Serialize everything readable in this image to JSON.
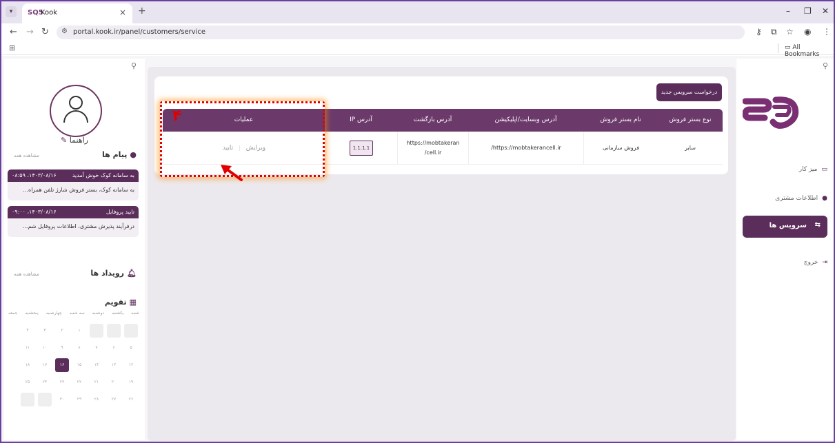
{
  "browser": {
    "tab_title": "Kook",
    "tab_favicon": "SQ5",
    "url": "portal.kook.ir/panel/customers/service",
    "all_bookmarks": "All Bookmarks"
  },
  "left_panel": {
    "username": "راهنما",
    "messages": {
      "title": "پیام ها",
      "see_all": "مشاهده همه",
      "items": [
        {
          "title": "به سامانه کوک خوش آمدید",
          "time": "۱۴۰۳/۰۸/۱۶، ۰۸:۵۹",
          "body": "به سامانه کوک، بستر فروش شارژ تلفن همراه..."
        },
        {
          "title": "تایید پروفایل",
          "time": "۱۴۰۳/۰۸/۱۶، ۰۹:۰۰",
          "body": "درفرآیند پذیرش مشتری، اطلاعات پروفایل شم..."
        }
      ]
    },
    "events": {
      "title": "رویداد ها",
      "see_all": "مشاهده همه"
    },
    "calendar": {
      "title": "تقویم",
      "day_names": [
        "شنبه",
        "یکشنبه",
        "دوشنبه",
        "سه شنبه",
        "چهارشنبه",
        "پنجشنبه",
        "جمعه"
      ],
      "weeks": [
        [
          "",
          "",
          "",
          "۱",
          "۲",
          "۳",
          "۴"
        ],
        [
          "۵",
          "۶",
          "۷",
          "۸",
          "۹",
          "۱۰",
          "۱۱"
        ],
        [
          "۱۲",
          "۱۳",
          "۱۴",
          "۱۵",
          "۱۶",
          "۱۷",
          "۱۸"
        ],
        [
          "۱۹",
          "۲۰",
          "۲۱",
          "۲۲",
          "۲۳",
          "۲۴",
          "۲۵"
        ],
        [
          "۲۶",
          "۲۷",
          "۲۸",
          "۲۹",
          "۳۰",
          "",
          ""
        ]
      ],
      "today": "۱۶"
    }
  },
  "main": {
    "new_request_button": "درخواست سرویس جدید",
    "table": {
      "headers": {
        "type": "نوع بستر فروش",
        "name": "نام بستر فروش",
        "website": "آدرس وبسایت/اپلیکیشن",
        "callback": "آدرس بازگشت",
        "ip": "آدرس IP",
        "operations": "عملیات"
      },
      "row": {
        "type": "سایر",
        "name": "فروش سازمانی",
        "website": "/https://mobtakerancell.ir",
        "callback_line1": "https://mobtakeran",
        "callback_line2": "/cell.ir",
        "ip": "1.1.1.1",
        "edit": "ویرایش",
        "confirm": "تایید"
      }
    }
  },
  "annotation": {
    "number": "۴",
    "color": "#e00000"
  },
  "sidebar": {
    "items": [
      {
        "label": "میز کار",
        "icon": "desk-icon"
      },
      {
        "label": "اطلاعات مشتری",
        "icon": "user-icon"
      },
      {
        "label": "سرویس ها",
        "icon": "swap-icon",
        "active": true
      },
      {
        "label": "خروج",
        "icon": "logout-icon"
      }
    ]
  },
  "colors": {
    "brand": "#5b2d5b",
    "table_header": "#6b3a6b",
    "frame": "#6b3fa0"
  }
}
